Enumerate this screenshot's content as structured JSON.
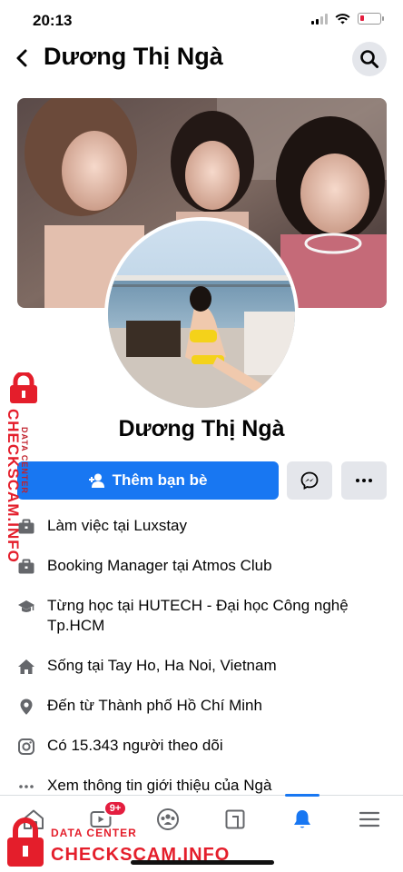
{
  "status_bar": {
    "time": "20:13"
  },
  "header": {
    "title": "Dương Thị Ngà"
  },
  "profile": {
    "name": "Dương Thị Ngà"
  },
  "actions": {
    "add_friend_label": "Thêm bạn bè"
  },
  "details": [
    {
      "icon": "briefcase-icon",
      "text": "Làm việc tại Luxstay"
    },
    {
      "icon": "briefcase-icon",
      "text": "Booking Manager tại Atmos Club"
    },
    {
      "icon": "graduation-cap-icon",
      "text": "Từng học tại HUTECH - Đại học Công nghệ Tp.HCM"
    },
    {
      "icon": "home-icon",
      "text": "Sống tại Tay Ho, Ha Noi, Vietnam"
    },
    {
      "icon": "location-pin-icon",
      "text": "Đến từ Thành phố Hồ Chí Minh"
    },
    {
      "icon": "instagram-icon",
      "text": "Có 15.343 người theo dõi"
    },
    {
      "icon": "more-dots-icon",
      "text": "Xem thông tin giới thiệu của Ngà"
    }
  ],
  "tab_bar": {
    "tabs": [
      "home-tab",
      "watch-tab",
      "groups-tab",
      "gaming-tab",
      "notifications-tab",
      "menu-tab"
    ],
    "watch_badge": "9+",
    "active": "notifications-tab"
  },
  "watermark": {
    "side_big": "CHECKSCAM.INFO",
    "side_small": "DATA CENTER",
    "bottom_small": "DATA CENTER",
    "bottom_big": "CHECKSCAM.INFO"
  },
  "colors": {
    "accent": "#1877f2",
    "badge": "#e41e3f",
    "watermark": "#e41e2b"
  }
}
